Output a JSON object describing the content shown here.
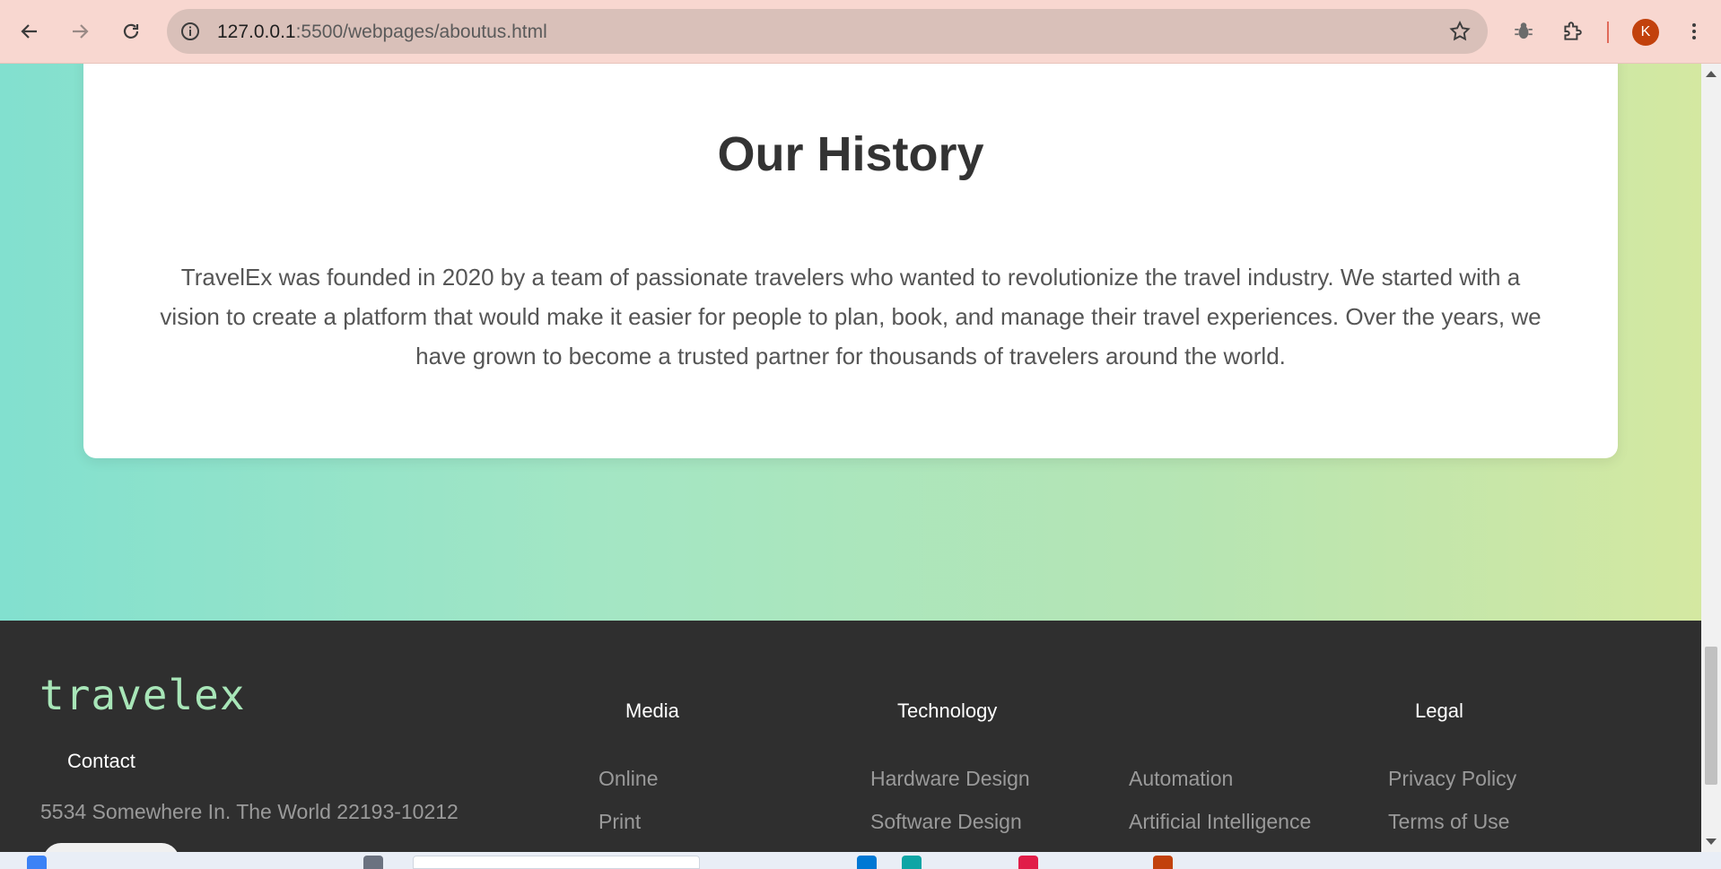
{
  "browser": {
    "url_host": "127.0.0.1",
    "url_path": ":5500/webpages/aboutus.html",
    "avatar_letter": "K",
    "accent": "#f8d7d0"
  },
  "history": {
    "title": "Our History",
    "body": "TravelEx was founded in 2020 by a team of passionate travelers who wanted to revolutionize the travel industry. We started with a vision to create a platform that would make it easier for people to plan, book, and manage their travel experiences. Over the years, we have grown to become a trusted partner for thousands of travelers around the world."
  },
  "footer": {
    "logo": "travelex",
    "contact_heading": "Contact",
    "address": "5534 Somewhere In. The World 22193-10212",
    "columns": {
      "media": {
        "heading": "Media",
        "links": [
          "Online",
          "Print"
        ]
      },
      "technology": {
        "heading": "Technology",
        "links": [
          "Hardware Design",
          "Software Design"
        ]
      },
      "technology2": {
        "links": [
          "Automation",
          "Artificial Intelligence"
        ]
      },
      "legal": {
        "heading": "Legal",
        "links": [
          "Privacy Policy",
          "Terms of Use"
        ]
      }
    }
  }
}
